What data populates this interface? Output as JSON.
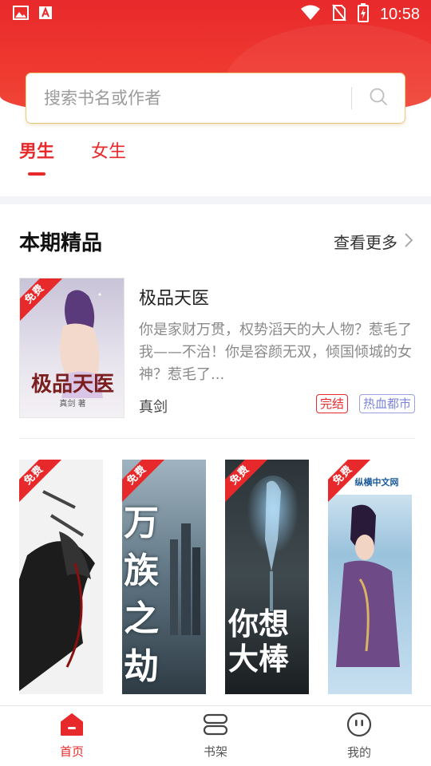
{
  "status_bar": {
    "time": "10:58"
  },
  "search": {
    "placeholder": "搜索书名或作者"
  },
  "gender_tabs": [
    {
      "label": "男生",
      "active": true
    },
    {
      "label": "女生",
      "active": false
    }
  ],
  "section": {
    "title": "本期精品",
    "more_label": "查看更多"
  },
  "featured": {
    "title": "极品天医",
    "description": "你是家财万贯，权势滔天的大人物？惹毛了我——不治！你是容颜无双，倾国倾城的女神？惹毛了...",
    "author": "真剑",
    "tags": [
      "完结",
      "热血都市"
    ],
    "free_badge": "免费",
    "cover_text": "极品天医",
    "cover_author": "真剑 著"
  },
  "covers": [
    {
      "badge": "免费",
      "cover_text": ""
    },
    {
      "badge": "免费",
      "cover_text": "万族之劫"
    },
    {
      "badge": "免费",
      "cover_text": "你想大棒"
    },
    {
      "badge": "免费",
      "cover_text": "纵横中文网"
    }
  ],
  "bottom_nav": [
    {
      "label": "首页",
      "icon": "home-icon",
      "active": true
    },
    {
      "label": "书架",
      "icon": "bookshelf-icon",
      "active": false
    },
    {
      "label": "我的",
      "icon": "profile-icon",
      "active": false
    }
  ],
  "colors": {
    "accent": "#e8292b",
    "tag_blue": "#7b84d9"
  }
}
